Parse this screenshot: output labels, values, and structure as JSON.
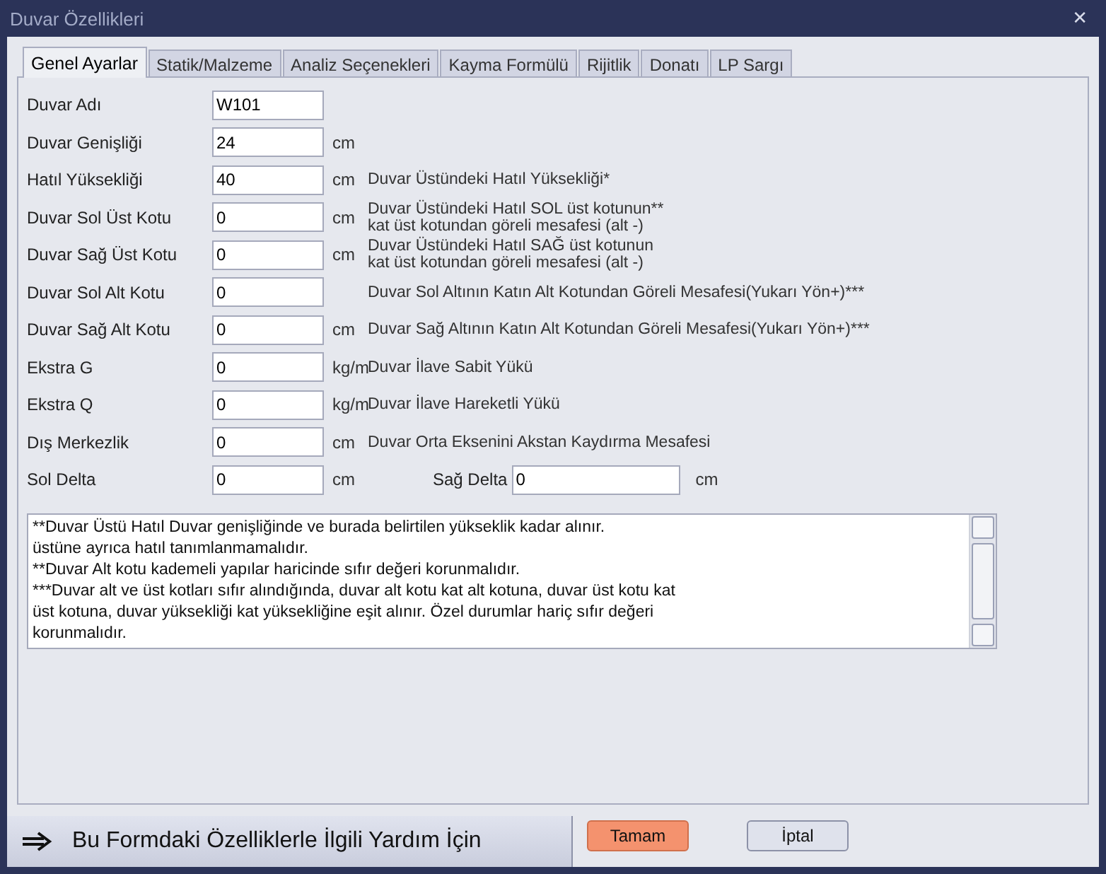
{
  "window": {
    "title": "Duvar Özellikleri",
    "close": "✕"
  },
  "tabs": [
    {
      "label": "Genel Ayarlar",
      "selected": true
    },
    {
      "label": "Statik/Malzeme",
      "selected": false
    },
    {
      "label": "Analiz Seçenekleri",
      "selected": false
    },
    {
      "label": "Kayma Formülü",
      "selected": false
    },
    {
      "label": "Rijitlik",
      "selected": false
    },
    {
      "label": "Donatı",
      "selected": false
    },
    {
      "label": "LP Sargı",
      "selected": false
    }
  ],
  "fields": [
    {
      "label": "Duvar Adı",
      "value": "W101"
    },
    {
      "label": "Duvar Genişliği",
      "value": "24",
      "unit": "cm"
    },
    {
      "label": "Hatıl Yüksekliği",
      "value": "40",
      "unit": "cm",
      "description": [
        "Duvar Üstündeki Hatıl Yüksekliği*"
      ]
    },
    {
      "label": "Duvar Sol Üst Kotu",
      "value": "0",
      "unit": "cm",
      "description": [
        "Duvar Üstündeki Hatıl SOL üst kotunun**",
        "kat üst kotundan göreli mesafesi (alt -)"
      ]
    },
    {
      "label": "Duvar Sağ Üst Kotu",
      "value": "0",
      "unit": "cm",
      "description": [
        "Duvar Üstündeki Hatıl SAĞ üst kotunun",
        "kat üst kotundan göreli mesafesi (alt -)"
      ]
    },
    {
      "label": "Duvar Sol Alt Kotu",
      "value": "0",
      "description": [
        "Duvar Sol Altının Katın Alt Kotundan Göreli Mesafesi(Yukarı Yön+)***"
      ]
    },
    {
      "label": "Duvar Sağ Alt Kotu",
      "value": "0",
      "unit": "cm",
      "description": [
        "Duvar Sağ Altının Katın Alt Kotundan Göreli Mesafesi(Yukarı Yön+)***"
      ]
    },
    {
      "label": "Ekstra G",
      "value": "0",
      "unit": "kg/m",
      "description": [
        "Duvar İlave Sabit Yükü"
      ]
    },
    {
      "label": "Ekstra Q",
      "value": "0",
      "unit": "kg/m",
      "description": [
        "Duvar İlave Hareketli Yükü"
      ]
    },
    {
      "label": "Dış Merkezlik",
      "value": "0",
      "unit": "cm",
      "description": [
        "Duvar Orta Eksenini Akstan Kaydırma Mesafesi"
      ]
    },
    {
      "label": "Sol Delta",
      "value": "0",
      "unit": "cm",
      "extra": {
        "label": "Sağ Delta",
        "value": "0",
        "unit": "cm"
      }
    }
  ],
  "notes": [
    "**Duvar Üstü Hatıl Duvar genişliğinde ve burada belirtilen yükseklik kadar alınır.",
    "üstüne ayrıca hatıl tanımlanmamalıdır.",
    "**Duvar Alt kotu kademeli yapılar haricinde sıfır değeri korunmalıdır.",
    "***Duvar alt ve üst kotları sıfır alındığında, duvar alt kotu kat alt kotuna, duvar üst kotu kat",
    "üst kotuna, duvar yüksekliği kat yüksekliğine eşit alınır. Özel durumlar hariç sıfır değeri",
    "korunmalıdır."
  ],
  "help_button": "Bu Formdaki Özelliklerle İlgili Yardım İçin",
  "buttons": [
    {
      "label": "Tamam",
      "kind": "primary"
    },
    {
      "label": "İptal",
      "kind": "normal"
    }
  ]
}
